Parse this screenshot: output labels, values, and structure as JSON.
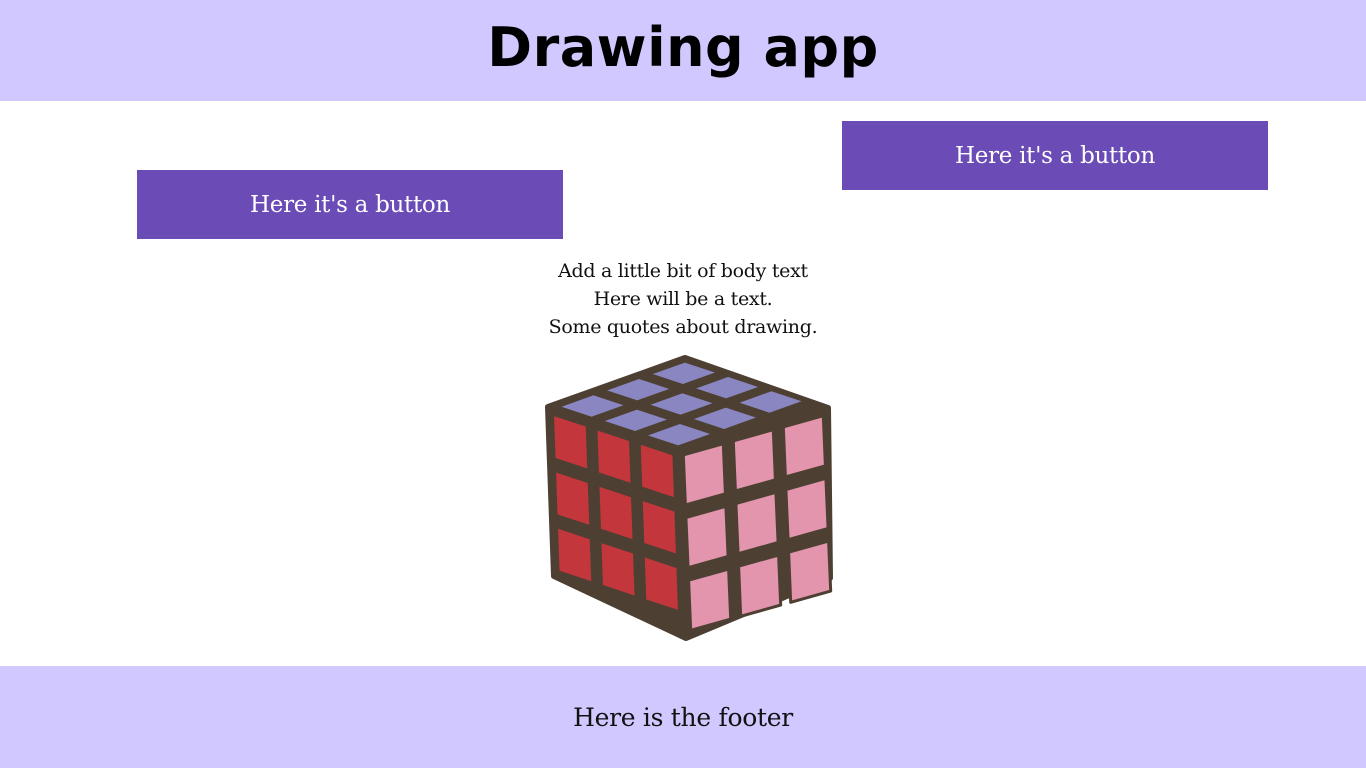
{
  "header": {
    "title": "Drawing app"
  },
  "buttons": {
    "left_label": "Here it's a button",
    "right_label": "Here it's a button"
  },
  "body_text": {
    "lines": [
      "Add a little bit of body text",
      "Here will be a text.",
      "Some quotes about drawing."
    ]
  },
  "illustration": {
    "icon": "rubiks-cube-icon"
  },
  "footer": {
    "text": "Here is the footer"
  },
  "colors": {
    "header_bg": "#d1c8ff",
    "button_bg": "#6b4bb6",
    "footer_bg": "#d1c8ff",
    "cube_top": "#8a86c2",
    "cube_left": "#c3363b",
    "cube_right": "#e395ad",
    "cube_outline": "#4d4032"
  }
}
